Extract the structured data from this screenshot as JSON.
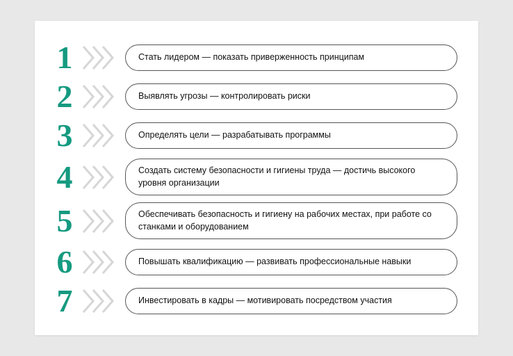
{
  "colors": {
    "accent": "#159a80",
    "chevron": "#d6d6d6",
    "border": "#555555",
    "page_bg": "#e8e8e8",
    "card_bg": "#ffffff"
  },
  "items": [
    {
      "n": "1",
      "text": "Стать лидером — показать приверженность принципам"
    },
    {
      "n": "2",
      "text": "Выявлять угрозы — контролировать риски"
    },
    {
      "n": "3",
      "text": "Определять цели — разрабатывать программы"
    },
    {
      "n": "4",
      "text": "Создать систему безопасности и гигиены труда — достичь высокого уровня организации"
    },
    {
      "n": "5",
      "text": "Обеспечивать безопасность и гигиену на рабочих местах, при работе со станками и оборудованием"
    },
    {
      "n": "6",
      "text": "Повышать квалификацию — развивать профессиональные навыки"
    },
    {
      "n": "7",
      "text": "Инвестировать в кадры — мотивировать посредством участия"
    }
  ]
}
